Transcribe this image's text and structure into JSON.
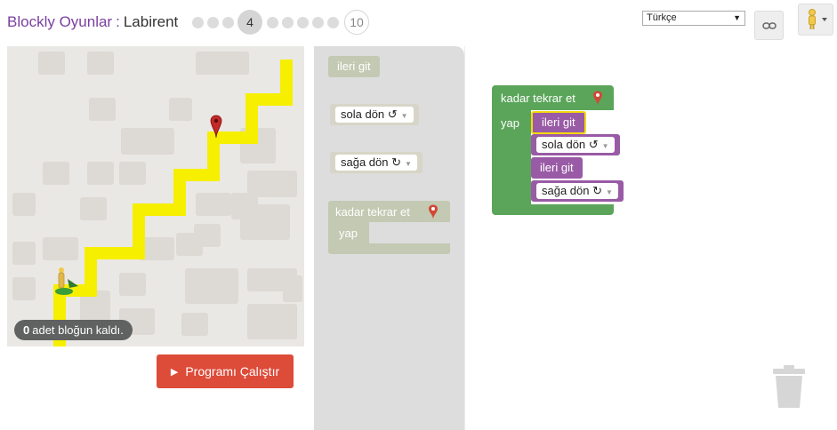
{
  "header": {
    "app_title": "Blockly Oyunlar",
    "separator": ":",
    "level_title": "Labirent",
    "current_level": "4",
    "last_level": "10"
  },
  "language": {
    "selected": "Türkçe"
  },
  "icons": {
    "link": "link-icon",
    "pegman": "pegman-icon",
    "trash": "trash-icon",
    "marker": "map-marker-icon"
  },
  "status": {
    "count": "0",
    "text": "adet bloğun kaldı."
  },
  "run_button": {
    "label": "Programı Çalıştır"
  },
  "toolbox": {
    "move_forward": "ileri git",
    "turn_left": "sola dön ↺",
    "turn_right": "sağa dön ↻",
    "repeat_until": "kadar tekrar et",
    "do": "yap"
  },
  "workspace": {
    "repeat_until": "kadar tekrar et",
    "do": "yap",
    "stmt1": "ileri git",
    "stmt2": "sola dön ↺",
    "stmt3": "ileri git",
    "stmt4": "sağa dön ↻"
  },
  "colors": {
    "loop": "#5ba55b",
    "movement": "#995ba5",
    "run": "#dd4b39",
    "path": "#f6f000",
    "brand": "#7b3fa0"
  }
}
